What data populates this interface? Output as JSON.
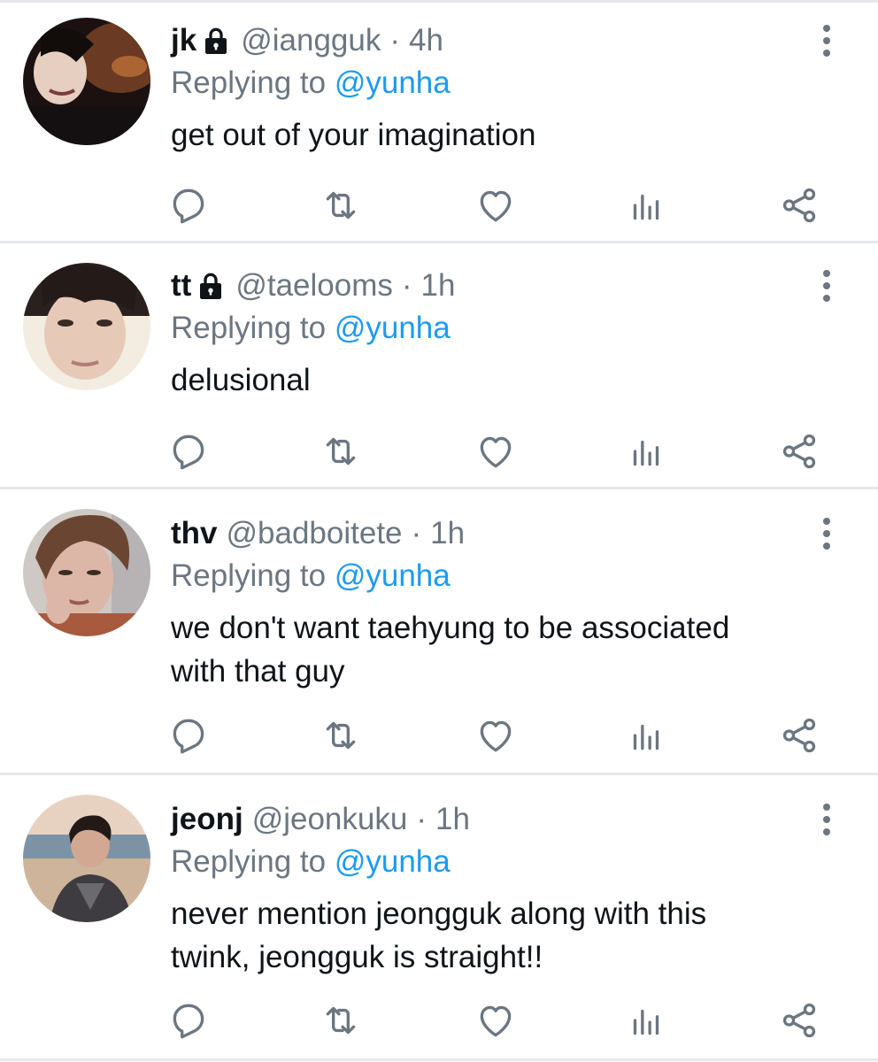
{
  "colors": {
    "name": "#0f1419",
    "secondary": "#6b7681",
    "mention": "#1d9bf0",
    "divider": "#e6e8eb"
  },
  "icons": {
    "reply": "reply-icon",
    "retweet": "retweet-icon",
    "like": "heart-icon",
    "views": "views-icon",
    "share": "share-icon",
    "more": "more-vertical-icon",
    "lock": "lock-icon"
  },
  "tweets": [
    {
      "name": "jk",
      "locked": true,
      "handle": "@iangguk",
      "separator": "·",
      "time": "4h",
      "replying_prefix": "Replying to",
      "replying_to": "@yunha",
      "text": "get out of your imagination"
    },
    {
      "name": "tt",
      "locked": true,
      "handle": "@taelooms",
      "separator": "·",
      "time": "1h",
      "replying_prefix": "Replying to",
      "replying_to": "@yunha",
      "text": "delusional"
    },
    {
      "name": "thv",
      "locked": false,
      "handle": "@badboitete",
      "separator": "·",
      "time": "1h",
      "replying_prefix": "Replying to",
      "replying_to": "@yunha",
      "text_lines": [
        "we don't want taehyung to be associated",
        "with that guy"
      ]
    },
    {
      "name": "jeonj",
      "locked": false,
      "handle": "@jeonkuku",
      "separator": "·",
      "time": "1h",
      "replying_prefix": "Replying to",
      "replying_to": "@yunha",
      "text_lines": [
        "never mention jeongguk along with this",
        "twink, jeongguk is straight!!"
      ]
    }
  ]
}
